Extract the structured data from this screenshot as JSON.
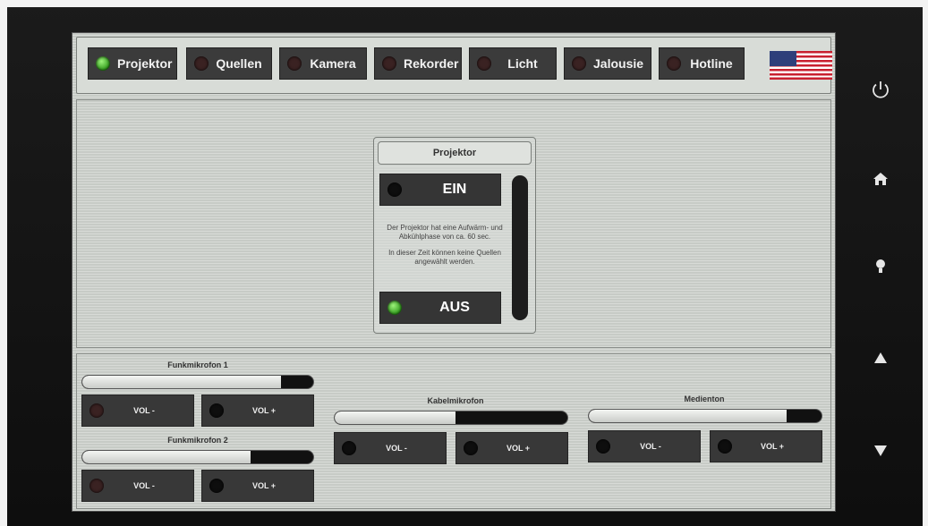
{
  "nav": {
    "items": [
      {
        "label": "Projektor",
        "active": true
      },
      {
        "label": "Quellen",
        "active": false
      },
      {
        "label": "Kamera",
        "active": false
      },
      {
        "label": "Rekorder",
        "active": false
      },
      {
        "label": "Licht",
        "active": false
      },
      {
        "label": "Jalousie",
        "active": false
      },
      {
        "label": "Hotline",
        "active": false
      }
    ],
    "flag_icon": "us-flag-icon"
  },
  "projector": {
    "title": "Projektor",
    "on_label": "EIN",
    "off_label": "AUS",
    "info_line1": "Der Projektor hat eine Aufwärm- und Abkühlphase von ca. 60 sec.",
    "info_line2": "In dieser Zeit können keine Quellen angewählt werden."
  },
  "audio": {
    "funk1": {
      "label": "Funkmikrofon 1",
      "level": 0.86,
      "vol_down": "VOL -",
      "vol_up": "VOL +"
    },
    "funk2": {
      "label": "Funkmikrofon 2",
      "level": 0.73,
      "vol_down": "VOL -",
      "vol_up": "VOL +"
    },
    "kabel": {
      "label": "Kabelmikrofon",
      "level": 0.52,
      "vol_down": "VOL -",
      "vol_up": "VOL +"
    },
    "medien": {
      "label": "Medienton",
      "level": 0.85,
      "vol_down": "VOL -",
      "vol_up": "VOL +"
    }
  },
  "side_controls": [
    "power-icon",
    "home-icon",
    "light-icon",
    "arrow-up-icon",
    "arrow-down-icon"
  ]
}
